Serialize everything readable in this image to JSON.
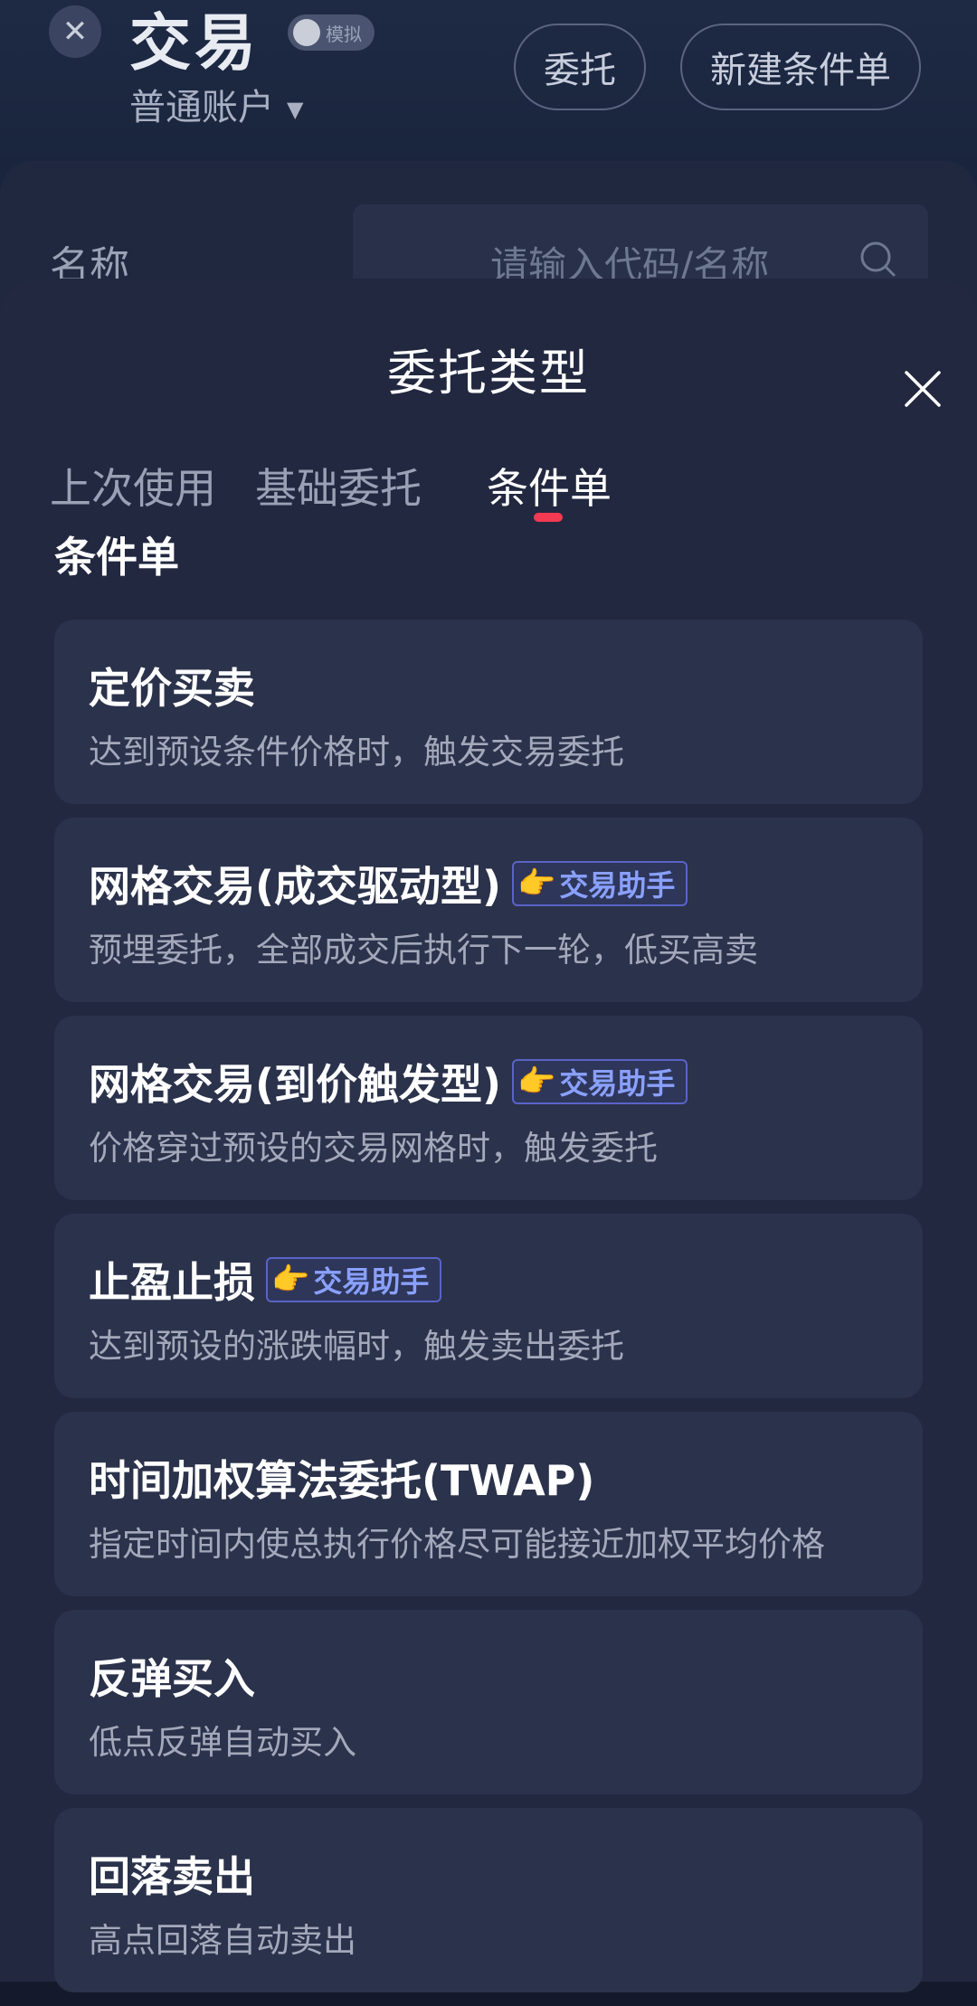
{
  "background": {
    "close_glyph": "✕",
    "title": "交易",
    "toggle_label": "模拟",
    "account": "普通账户",
    "account_caret": "▼",
    "buttons": {
      "order": "委托",
      "new_condition": "新建条件单"
    },
    "name_label": "名称",
    "search_placeholder": "请输入代码/名称"
  },
  "sheet": {
    "title": "委托类型",
    "tabs": [
      {
        "label": "上次使用",
        "active": false
      },
      {
        "label": "基础委托",
        "active": false
      },
      {
        "label": "条件单",
        "active": true
      }
    ],
    "section_title": "条件单",
    "items": [
      {
        "title": "定价买卖",
        "desc": "达到预设条件价格时，触发交易委托"
      },
      {
        "title": "网格交易(成交驱动型)",
        "badge": "交易助手",
        "desc": "预埋委托，全部成交后执行下一轮，低买高卖"
      },
      {
        "title": "网格交易(到价触发型)",
        "badge": "交易助手",
        "desc": "价格穿过预设的交易网格时，触发委托"
      },
      {
        "title": "止盈止损",
        "badge": "交易助手",
        "desc": "达到预设的涨跌幅时，触发卖出委托"
      },
      {
        "title": "时间加权算法委托(TWAP)",
        "desc": "指定时间内使总执行价格尽可能接近加权平均价格"
      },
      {
        "title": "反弹买入",
        "desc": "低点反弹自动买入"
      },
      {
        "title": "回落卖出",
        "desc": "高点回落自动卖出"
      }
    ],
    "badge_icon": "pointing-hand-icon",
    "badge_emoji": "👉"
  },
  "colors": {
    "sheet_bg": "#222840",
    "card_bg": "#2b324b",
    "tab_indicator": "#f23a52",
    "badge_text": "#8aa0ff"
  }
}
